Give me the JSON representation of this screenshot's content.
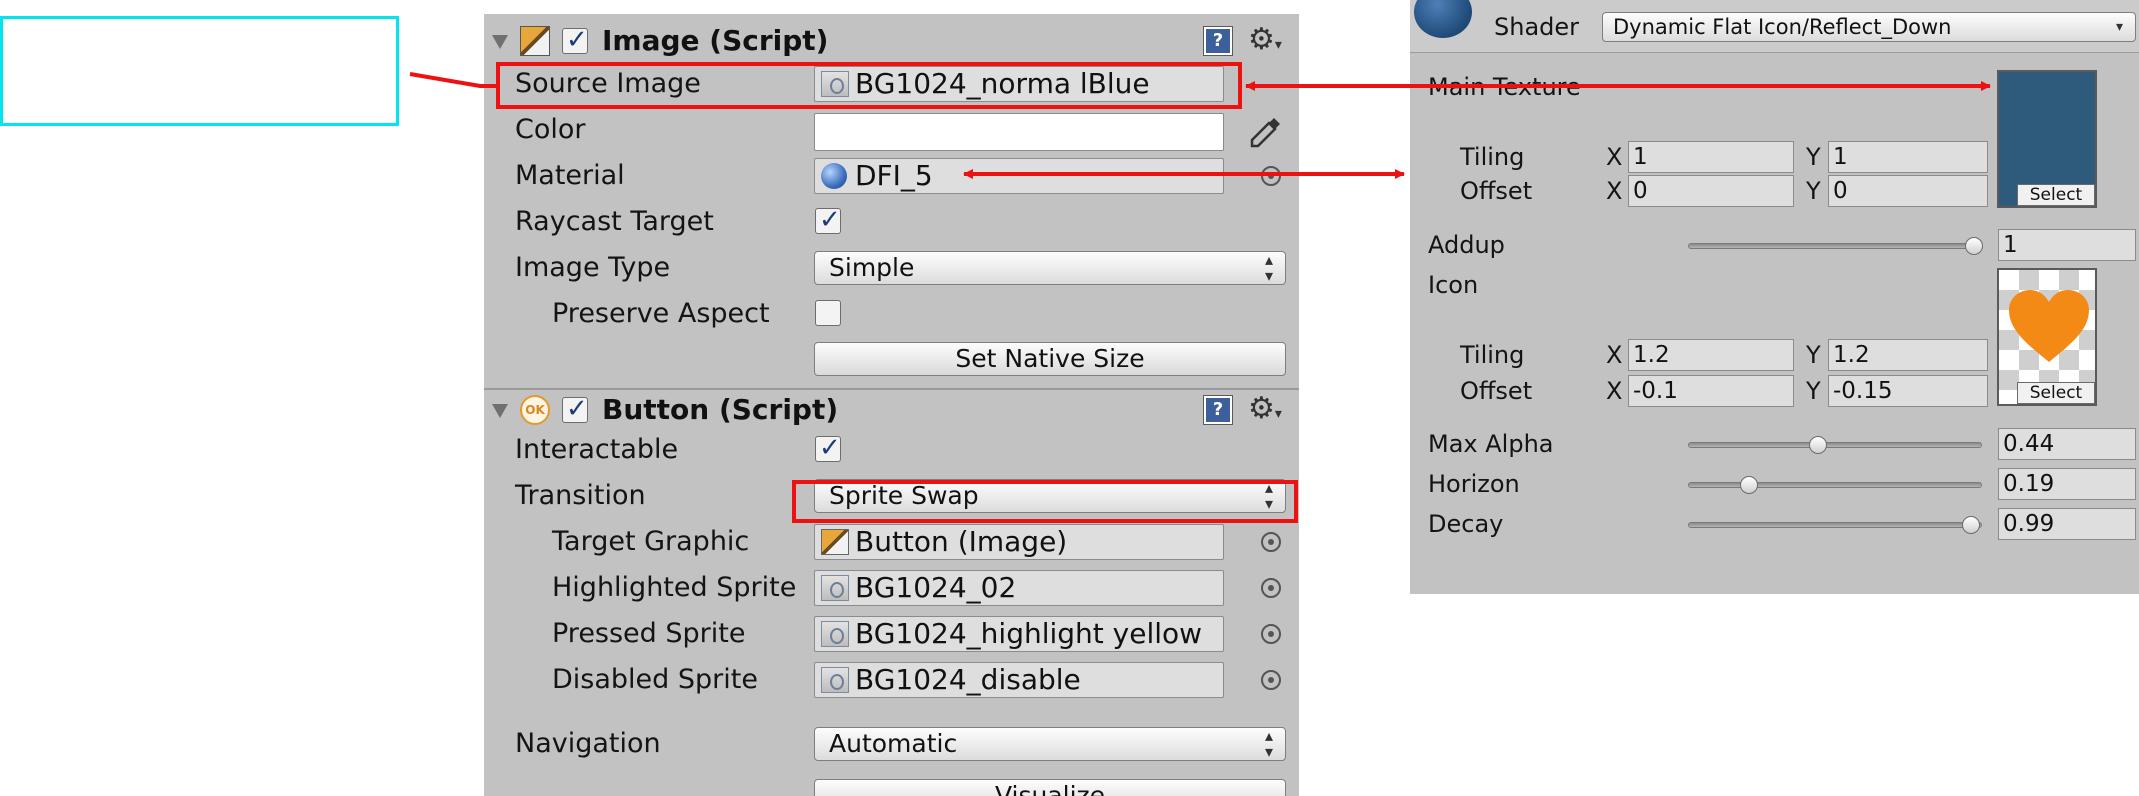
{
  "colors": {
    "highlight": "#ee1111",
    "preview_border": "#00e5ee",
    "main_texture": "#2e5a7c",
    "icon_heart": "#f38a16",
    "panel_bg": "#c2c2c2"
  },
  "image_component": {
    "title": "Image (Script)",
    "enabled": true,
    "source_image": {
      "label": "Source Image",
      "value": "BG1024_norma lBlue"
    },
    "color": {
      "label": "Color"
    },
    "material": {
      "label": "Material",
      "value": "DFI_5"
    },
    "raycast_target": {
      "label": "Raycast Target",
      "checked": true
    },
    "image_type": {
      "label": "Image Type",
      "value": "Simple"
    },
    "preserve_aspect": {
      "label": "Preserve Aspect",
      "checked": false
    },
    "set_native_size": "Set Native Size"
  },
  "button_component": {
    "title": "Button (Script)",
    "icon_text": "OK",
    "enabled": true,
    "interactable": {
      "label": "Interactable",
      "checked": true
    },
    "transition": {
      "label": "Transition",
      "value": "Sprite Swap"
    },
    "target_graphic": {
      "label": "Target Graphic",
      "value": "Button (Image)"
    },
    "highlighted_sprite": {
      "label": "Highlighted Sprite",
      "value": "BG1024_02"
    },
    "pressed_sprite": {
      "label": "Pressed Sprite",
      "value": "BG1024_highlight yellow"
    },
    "disabled_sprite": {
      "label": "Disabled Sprite",
      "value": "BG1024_disable"
    },
    "navigation": {
      "label": "Navigation",
      "value": "Automatic"
    },
    "visualize": "Visualize"
  },
  "material_panel": {
    "shader_label": "Shader",
    "shader_value": "Dynamic Flat Icon/Reflect_Down",
    "main_texture": {
      "label": "Main Texture",
      "tiling_label": "Tiling",
      "offset_label": "Offset",
      "tiling_x": "1",
      "tiling_y": "1",
      "offset_x": "0",
      "offset_y": "0",
      "select": "Select"
    },
    "addup": {
      "label": "Addup",
      "value": "1",
      "level": 1.0
    },
    "icon": {
      "label": "Icon",
      "tiling_label": "Tiling",
      "offset_label": "Offset",
      "tiling_x": "1.2",
      "tiling_y": "1.2",
      "offset_x": "-0.1",
      "offset_y": "-0.15",
      "select": "Select"
    },
    "max_alpha": {
      "label": "Max Alpha",
      "value": "0.44",
      "level": 0.44
    },
    "horizon": {
      "label": "Horizon",
      "value": "0.19",
      "level": 0.19
    },
    "decay": {
      "label": "Decay",
      "value": "0.99",
      "level": 0.99
    },
    "x_label": "X",
    "y_label": "Y"
  }
}
